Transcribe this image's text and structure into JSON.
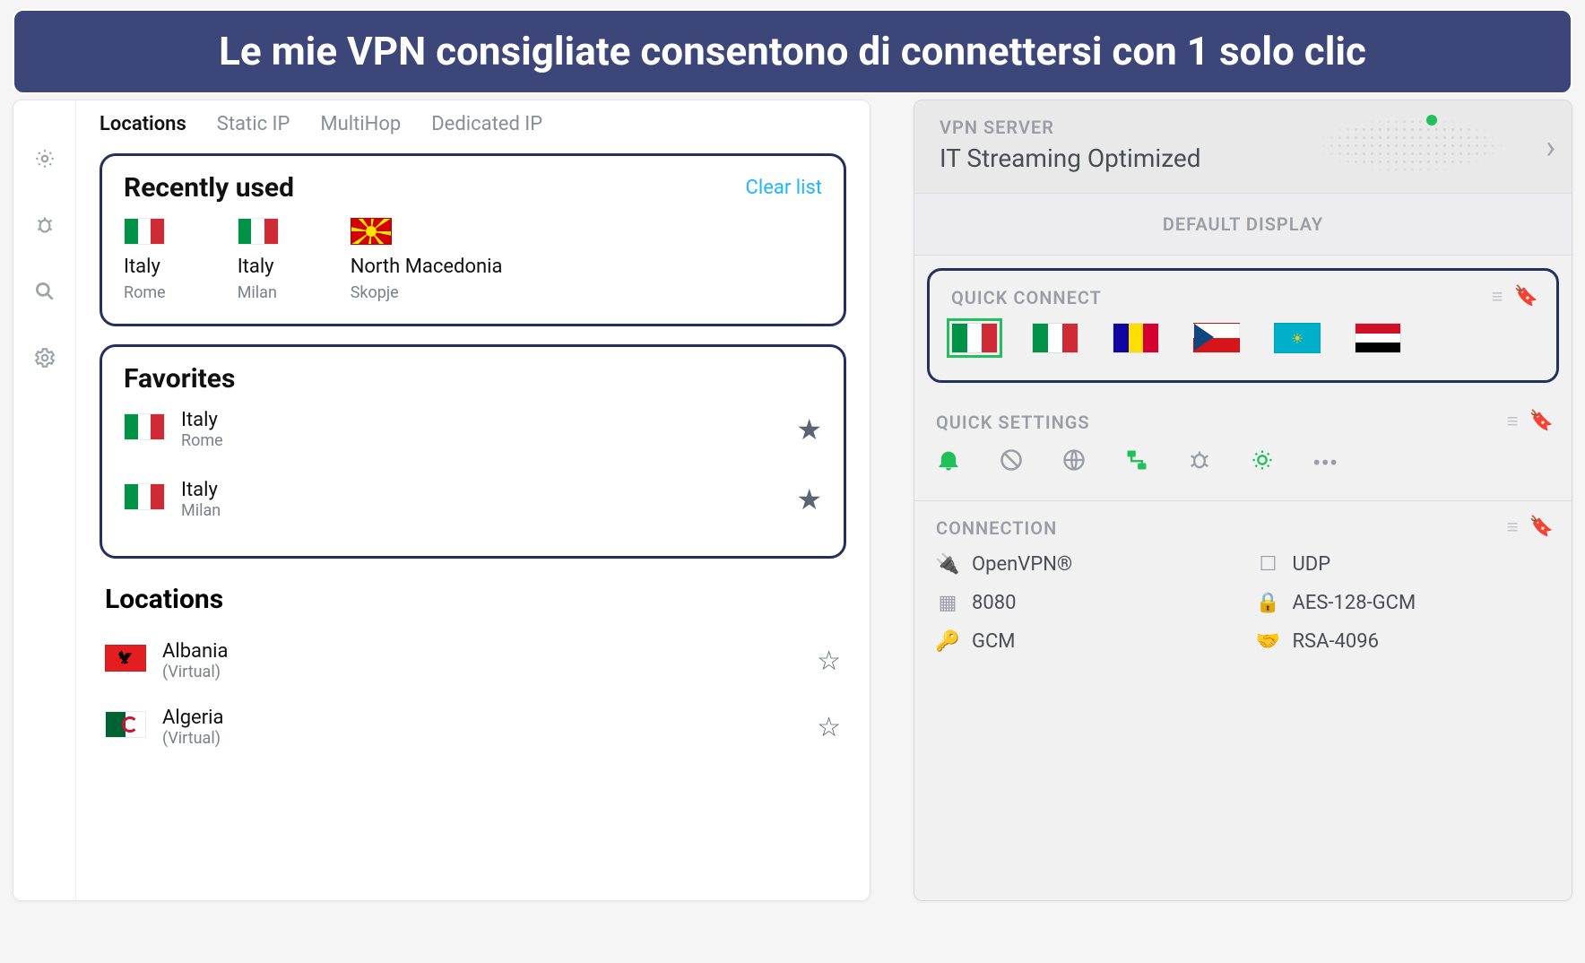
{
  "banner": "Le mie VPN consigliate consentono di connettersi con 1 solo clic",
  "left": {
    "tabs": [
      "Locations",
      "Static IP",
      "MultiHop",
      "Dedicated IP"
    ],
    "recent": {
      "title": "Recently used",
      "clear": "Clear list",
      "items": [
        {
          "country": "Italy",
          "city": "Rome",
          "flag": "it"
        },
        {
          "country": "Italy",
          "city": "Milan",
          "flag": "it"
        },
        {
          "country": "North Macedonia",
          "city": "Skopje",
          "flag": "mk"
        }
      ]
    },
    "favorites": {
      "title": "Favorites",
      "items": [
        {
          "country": "Italy",
          "city": "Rome",
          "flag": "it"
        },
        {
          "country": "Italy",
          "city": "Milan",
          "flag": "it"
        }
      ]
    },
    "locations": {
      "title": "Locations",
      "items": [
        {
          "country": "Albania",
          "sub": "(Virtual)",
          "flag": "al"
        },
        {
          "country": "Algeria",
          "sub": "(Virtual)",
          "flag": "dz"
        }
      ]
    }
  },
  "right": {
    "server_label": "VPN SERVER",
    "server_value": "IT Streaming Optimized",
    "default_display": "DEFAULT DISPLAY",
    "quick_connect": {
      "title": "QUICK CONNECT",
      "flags": [
        "it",
        "it",
        "ad",
        "cz",
        "kz",
        "eg"
      ],
      "active_index": 0
    },
    "quick_settings": {
      "title": "QUICK SETTINGS"
    },
    "connection": {
      "title": "CONNECTION",
      "items": [
        {
          "icon": "plug-icon",
          "label": "OpenVPN®"
        },
        {
          "icon": "udp-icon",
          "label": "UDP"
        },
        {
          "icon": "port-icon",
          "label": "8080"
        },
        {
          "icon": "lock-icon",
          "label": "AES-128-GCM"
        },
        {
          "icon": "key-icon",
          "label": "GCM"
        },
        {
          "icon": "handshake-icon",
          "label": "RSA-4096"
        }
      ]
    }
  }
}
